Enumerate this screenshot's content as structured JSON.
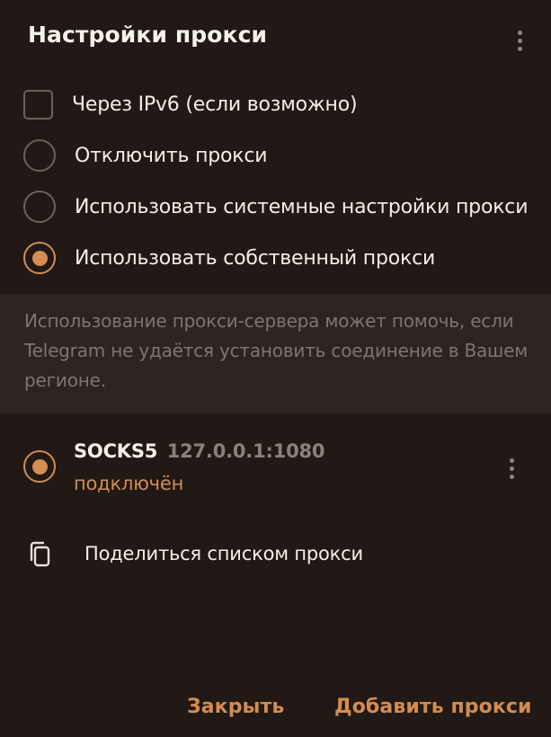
{
  "dialog": {
    "title": "Настройки прокси",
    "menu_icon": "more-vertical-icon"
  },
  "options": {
    "ipv6": {
      "label": "Через IPv6 (если возможно)",
      "checked": false
    },
    "disable": {
      "label": "Отключить прокси",
      "selected": false
    },
    "system": {
      "label": "Использовать системные настройки прокси",
      "selected": false
    },
    "custom": {
      "label": "Использовать собственный прокси",
      "selected": true
    }
  },
  "info": {
    "text": "Использование прокси-сервера может помочь, если Telegram не удаётся установить соединение в Вашем регионе."
  },
  "proxies": [
    {
      "type": "SOCKS5",
      "address": "127.0.0.1:1080",
      "status": "подключён",
      "selected": true,
      "menu_icon": "more-vertical-icon"
    }
  ],
  "share": {
    "icon": "copy-icon",
    "label": "Поделиться списком прокси"
  },
  "buttons": {
    "close": "Закрыть",
    "add": "Добавить прокси"
  },
  "colors": {
    "background": "#211915",
    "info_background": "#2d241e",
    "accent": "#d38c52",
    "text": "#f3eee8",
    "muted_text": "#7e756f"
  }
}
